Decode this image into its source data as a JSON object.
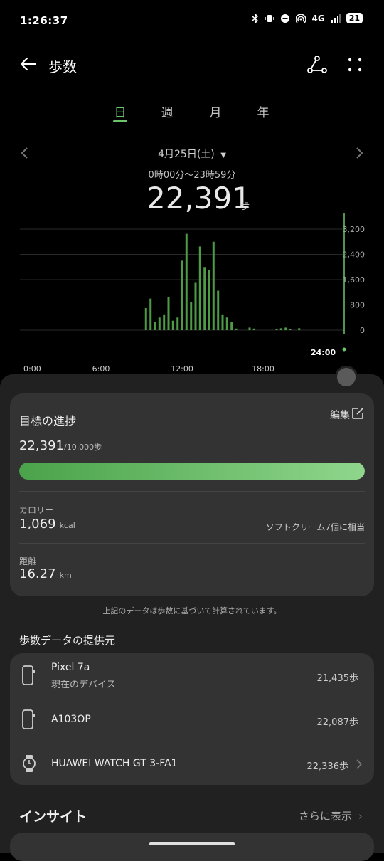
{
  "status": {
    "time": "1:26:37",
    "network": "4G",
    "battery": "21"
  },
  "header": {
    "title": "歩数"
  },
  "tabs": [
    "日",
    "週",
    "月",
    "年"
  ],
  "date": {
    "label": "4月25日(土)",
    "range": "0時00分〜23時59分",
    "steps": "22,391",
    "steps_unit": "歩"
  },
  "colors": {
    "accent": "#6cc56a",
    "bar": "#4f9a47",
    "card": "#333333",
    "sheet": "#212121"
  },
  "chart_data": {
    "type": "bar",
    "x_tick_labels": [
      "0:00",
      "6:00",
      "12:00",
      "18:00",
      "24:00"
    ],
    "y_tick_labels": [
      "3,200",
      "2,400",
      "1,600",
      "800",
      "0"
    ],
    "ylim": [
      0,
      3200
    ],
    "xlim": [
      0,
      24
    ],
    "grid": true,
    "bars": [
      {
        "hour": 9.33,
        "value": 700
      },
      {
        "hour": 9.67,
        "value": 1000
      },
      {
        "hour": 10.0,
        "value": 250
      },
      {
        "hour": 10.33,
        "value": 400
      },
      {
        "hour": 10.67,
        "value": 500
      },
      {
        "hour": 11.0,
        "value": 1050
      },
      {
        "hour": 11.33,
        "value": 300
      },
      {
        "hour": 11.67,
        "value": 400
      },
      {
        "hour": 12.0,
        "value": 2200
      },
      {
        "hour": 12.33,
        "value": 3050
      },
      {
        "hour": 12.67,
        "value": 900
      },
      {
        "hour": 13.0,
        "value": 1500
      },
      {
        "hour": 13.33,
        "value": 2650
      },
      {
        "hour": 13.67,
        "value": 2000
      },
      {
        "hour": 14.0,
        "value": 1900
      },
      {
        "hour": 14.33,
        "value": 2800
      },
      {
        "hour": 14.67,
        "value": 1250
      },
      {
        "hour": 15.0,
        "value": 500
      },
      {
        "hour": 15.33,
        "value": 400
      },
      {
        "hour": 15.67,
        "value": 250
      },
      {
        "hour": 16.0,
        "value": 50
      },
      {
        "hour": 17.0,
        "value": 80
      },
      {
        "hour": 17.33,
        "value": 50
      },
      {
        "hour": 19.0,
        "value": 40
      },
      {
        "hour": 19.33,
        "value": 60
      },
      {
        "hour": 19.67,
        "value": 80
      },
      {
        "hour": 20.0,
        "value": 40
      },
      {
        "hour": 20.67,
        "value": 60
      }
    ]
  },
  "goal": {
    "title": "目標の進捗",
    "edit_label": "編集",
    "value": "22,391",
    "target": "/10,000歩",
    "progress": 1.0
  },
  "calorie": {
    "label": "カロリー",
    "value": "1,069",
    "unit": "kcal",
    "note": "ソフトクリーム7個に相当"
  },
  "distance": {
    "label": "距離",
    "value": "16.27",
    "unit": "km"
  },
  "footnote": "上記のデータは歩数に基づいて計算されています。",
  "sources": {
    "title": "歩数データの提供元",
    "items": [
      {
        "name": "Pixel 7a",
        "sub": "現在のデバイス",
        "count": "21,435歩",
        "icon": "phone-icon"
      },
      {
        "name": "A103OP",
        "sub": "",
        "count": "22,087歩",
        "icon": "phone-icon"
      },
      {
        "name": "HUAWEI WATCH GT 3-FA1",
        "sub": "",
        "count": "22,336歩",
        "icon": "watch-icon"
      }
    ]
  },
  "insight": {
    "title": "インサイト",
    "more": "さらに表示"
  }
}
